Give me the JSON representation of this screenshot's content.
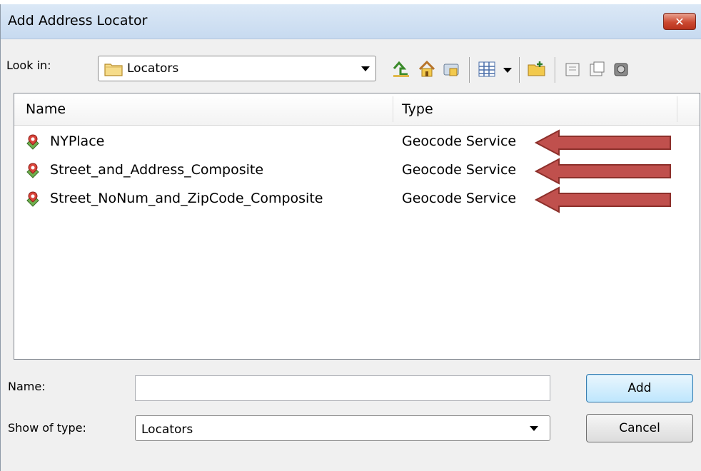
{
  "window": {
    "title": "Add Address Locator",
    "close_glyph": "✕"
  },
  "toolbar": {
    "look_in_label": "Look in:",
    "look_in_value": "Locators",
    "icons": [
      "up-one-level-icon",
      "home-folder-icon",
      "connect-folder-icon",
      "view-menu-icon",
      "new-folder-icon",
      "new-item-icon",
      "new-locator-icon",
      "geocode-service-icon"
    ]
  },
  "file_list": {
    "columns": [
      "Name",
      "Type"
    ],
    "rows": [
      {
        "name": "NYPlace",
        "type": "Geocode Service"
      },
      {
        "name": "Street_and_Address_Composite",
        "type": "Geocode Service"
      },
      {
        "name": "Street_NoNum_and_ZipCode_Composite",
        "type": "Geocode Service"
      }
    ]
  },
  "form": {
    "name_label": "Name:",
    "name_value": "",
    "show_type_label": "Show of type:",
    "show_type_value": "Locators"
  },
  "buttons": {
    "add": "Add",
    "cancel": "Cancel"
  },
  "annotation": {
    "arrow_color": "#c0504d",
    "arrow_border": "#8c2f2a"
  }
}
